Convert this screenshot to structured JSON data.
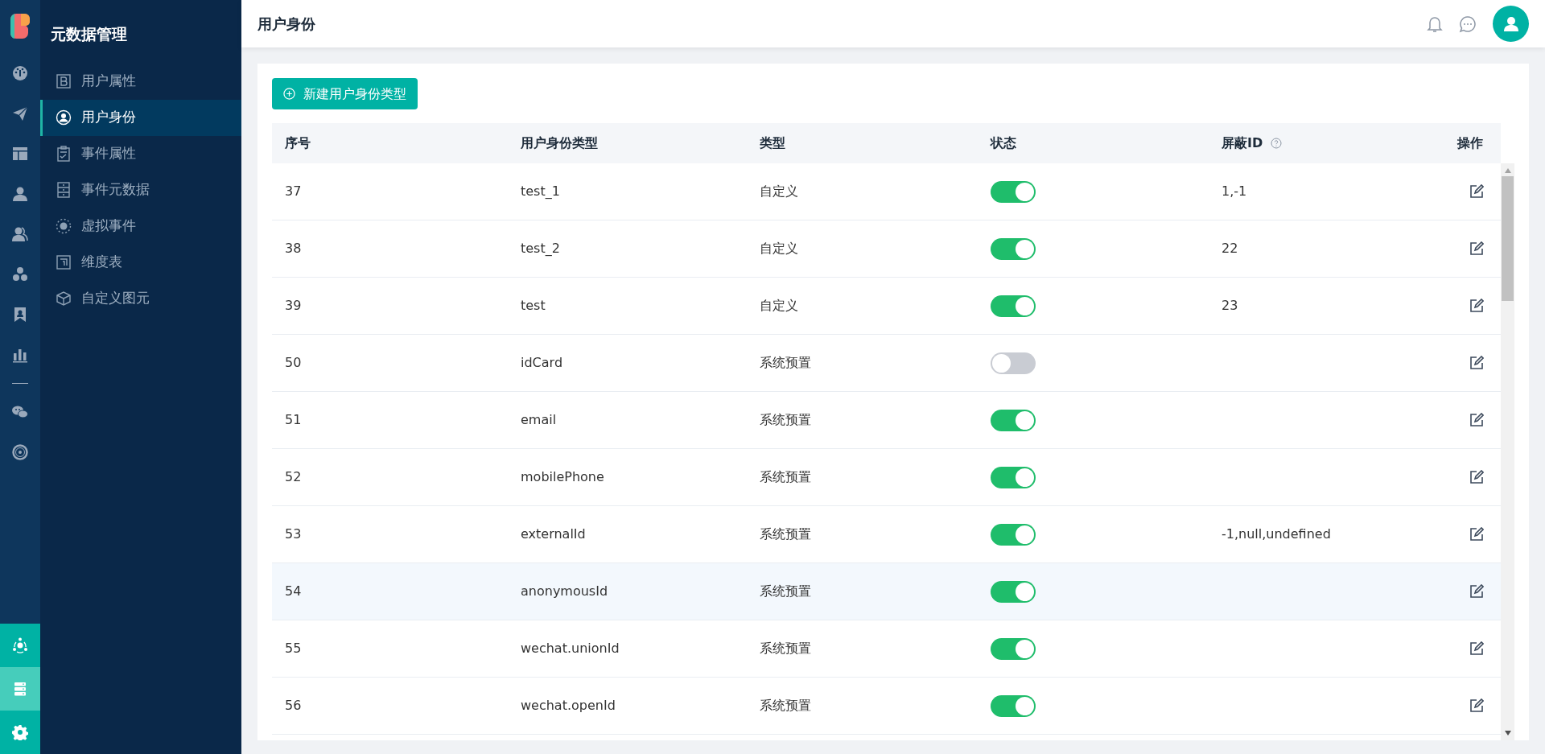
{
  "rail": {
    "bottom_items": [
      {
        "selected": false
      },
      {
        "selected": true
      },
      {
        "selected": false
      }
    ]
  },
  "sidebar": {
    "title": "元数据管理",
    "items": [
      {
        "label": "用户属性",
        "selected": false
      },
      {
        "label": "用户身份",
        "selected": true
      },
      {
        "label": "事件属性",
        "selected": false
      },
      {
        "label": "事件元数据",
        "selected": false
      },
      {
        "label": "虚拟事件",
        "selected": false
      },
      {
        "label": "维度表",
        "selected": false
      },
      {
        "label": "自定义图元",
        "selected": false
      }
    ]
  },
  "header": {
    "title": "用户身份"
  },
  "create_button": {
    "label": "新建用户身份类型"
  },
  "table": {
    "columns": [
      "序号",
      "用户身份类型",
      "类型",
      "状态",
      "屏蔽ID",
      "操作"
    ],
    "rows": [
      {
        "id": "37",
        "name": "test_1",
        "type": "自定义",
        "on": true,
        "blocked_ids": "1,-1",
        "highlighted": false
      },
      {
        "id": "38",
        "name": "test_2",
        "type": "自定义",
        "on": true,
        "blocked_ids": "22",
        "highlighted": false
      },
      {
        "id": "39",
        "name": "test",
        "type": "自定义",
        "on": true,
        "blocked_ids": "23",
        "highlighted": false
      },
      {
        "id": "50",
        "name": "idCard",
        "type": "系统预置",
        "on": false,
        "blocked_ids": "",
        "highlighted": false
      },
      {
        "id": "51",
        "name": "email",
        "type": "系统预置",
        "on": true,
        "blocked_ids": "",
        "highlighted": false
      },
      {
        "id": "52",
        "name": "mobilePhone",
        "type": "系统预置",
        "on": true,
        "blocked_ids": "",
        "highlighted": false
      },
      {
        "id": "53",
        "name": "externalId",
        "type": "系统预置",
        "on": true,
        "blocked_ids": "-1,null,undefined",
        "highlighted": false
      },
      {
        "id": "54",
        "name": "anonymousId",
        "type": "系统预置",
        "on": true,
        "blocked_ids": "",
        "highlighted": true
      },
      {
        "id": "55",
        "name": "wechat.unionId",
        "type": "系统预置",
        "on": true,
        "blocked_ids": "",
        "highlighted": false
      },
      {
        "id": "56",
        "name": "wechat.openId",
        "type": "系统预置",
        "on": true,
        "blocked_ids": "",
        "highlighted": false
      }
    ]
  }
}
